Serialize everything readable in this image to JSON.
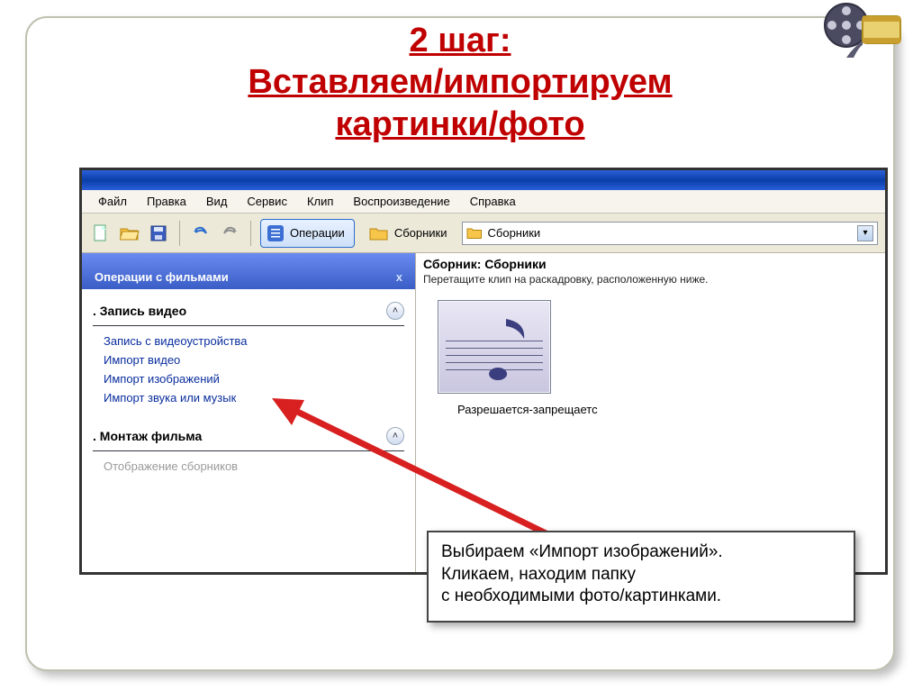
{
  "title": {
    "line1": "2 шаг:",
    "line2": "Вставляем/импортируем",
    "line3": "картинки/фото"
  },
  "menubar": [
    "Файл",
    "Правка",
    "Вид",
    "Сервис",
    "Клип",
    "Воспроизведение",
    "Справка"
  ],
  "toolbar": {
    "operations": "Операции",
    "collections": "Сборники",
    "combo_value": "Сборники"
  },
  "task_pane": {
    "header": "Операции с фильмами",
    "close": "x",
    "section1": {
      "num": ".",
      "label": "Запись видео",
      "links": [
        "Запись с видеоустройства",
        "Импорт видео",
        "Импорт изображений",
        "Импорт звука или музык"
      ]
    },
    "section2": {
      "num": ".",
      "label": "Монтаж фильма",
      "dimmed_link": "Отображение сборников"
    }
  },
  "right_pane": {
    "title": "Сборник: Сборники",
    "subtitle": "Перетащите клип на раскадровку, расположенную ниже.",
    "thumb_label": "Разрешается-запрещаетс"
  },
  "callout": {
    "line1": "Выбираем «Импорт изображений».",
    "line2": "Кликаем, находим папку",
    "line3": "с необходимыми фото/картинками."
  }
}
